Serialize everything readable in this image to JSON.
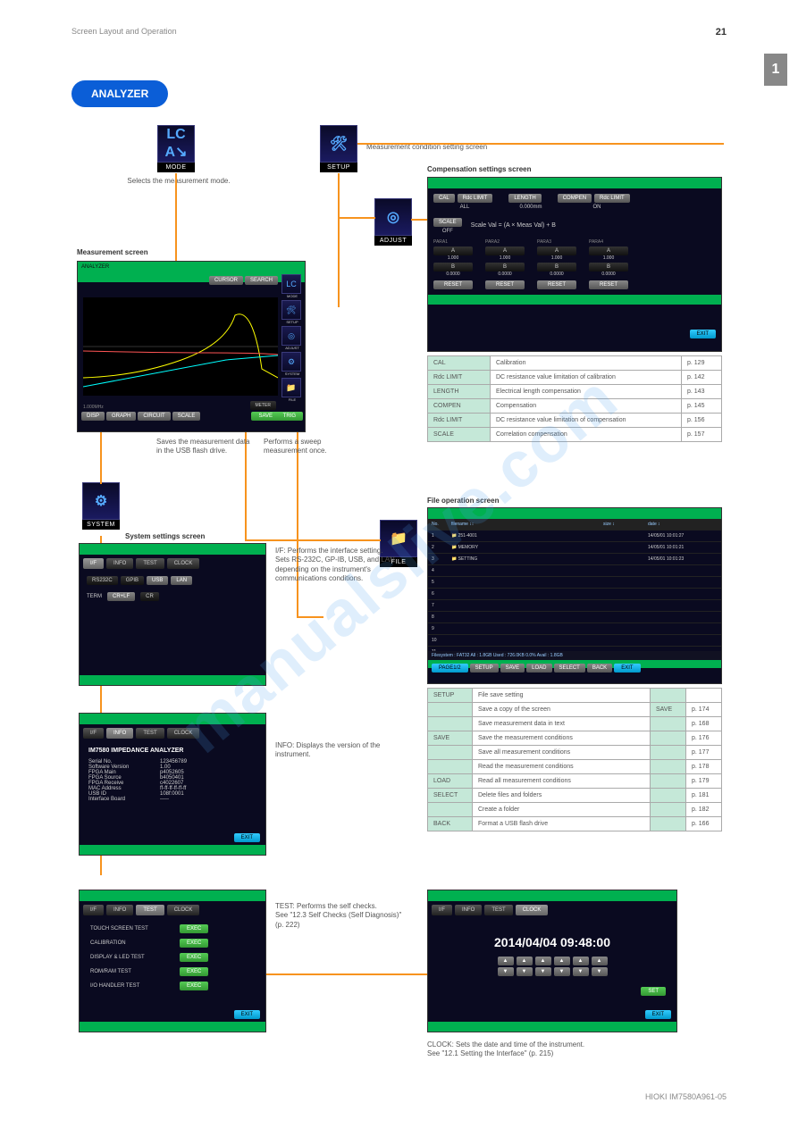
{
  "header": {
    "left": "Screen Layout and Operation",
    "right_page": "21"
  },
  "pill": "ANALYZER",
  "section_title": "Measurement screen",
  "icons": {
    "mode": "MODE",
    "mode_caption": "Selects the measurement mode.",
    "setup": "SETUP",
    "setup_title": "Measurement condition setting screen",
    "adjust": "ADJUST",
    "adjust_title": "Compensation settings screen",
    "system": "SYSTEM",
    "system_title": "System settings screen",
    "file": "FILE",
    "file_title": "File operation screen"
  },
  "analyzer_screen": {
    "title": "ANALYZER",
    "top_buttons": [
      "CURSOR",
      "SEARCH"
    ],
    "bottom_buttons": [
      "DISP",
      "GRAPH",
      "CIRCUIT",
      "SCALE"
    ],
    "save": "SAVE",
    "trig": "TRIG",
    "side": [
      "MODE",
      "SETUP",
      "ADJUST",
      "SYSTEM",
      "FILE"
    ],
    "meter": "METER"
  },
  "adjust_screen": {
    "btns": {
      "cal": "CAL",
      "rdc1": "Rdc LIMIT",
      "length": "LENGTH",
      "compen": "COMPEN",
      "rdc2": "Rdc LIMIT"
    },
    "vals": {
      "all": "ALL",
      "len": "0.000mm",
      "on": "ON"
    },
    "scale_lbl": "SCALE",
    "scale_state": "OFF",
    "scale_formula": "Scale Val = (A × Meas Val) + B",
    "param_labels": [
      "PARA1",
      "PARA2",
      "PARA3",
      "PARA4"
    ],
    "a": "A",
    "aval": "1.000",
    "b": "B",
    "bval": "0.0000",
    "reset": "RESET",
    "exit": "EXIT"
  },
  "adjust_table": {
    "rows": [
      [
        "CAL",
        "Calibration",
        "p. 129"
      ],
      [
        "Rdc LIMIT",
        "DC resistance value limitation of calibration",
        "p. 142"
      ],
      [
        "LENGTH",
        "Electrical length compensation",
        "p. 143"
      ],
      [
        "COMPEN",
        "Compensation",
        "p. 145"
      ],
      [
        "Rdc LIMIT",
        "DC resistance value limitation of compensation",
        "p. 156"
      ],
      [
        "SCALE",
        "Correlation compensation",
        "p. 157"
      ]
    ]
  },
  "file_screen": {
    "headers": [
      "No.",
      "filename ↕↕",
      "size ↕",
      "date ↕"
    ],
    "rows": [
      [
        "1",
        "251-4001",
        "",
        "14/05/01 10:01:27"
      ],
      [
        "2",
        "MEMORY",
        "",
        "14/05/01 10:01:21"
      ],
      [
        "3",
        "SETTING",
        "",
        "14/05/01 10:01:23"
      ]
    ],
    "fsline": "Filesystem : FAT32  All :  1.8GB  Used :  726.0KB  0.0%  Avail :  1.8GB",
    "btns": [
      "PAGE1/2",
      "SETUP",
      "SAVE",
      "LOAD",
      "SELECT",
      "BACK",
      "EXIT"
    ]
  },
  "file_table": {
    "rows": [
      [
        "SETUP",
        "File save setting",
        "",
        ""
      ],
      [
        "",
        "Save a copy of the screen",
        "SAVE",
        "p. 174"
      ],
      [
        "",
        "Save measurement data in text",
        "",
        "p. 168"
      ],
      [
        "SAVE",
        "Save the measurement conditions",
        "",
        "p. 176"
      ],
      [
        "",
        "Save all measurement conditions",
        "",
        "p. 177"
      ],
      [
        "",
        "Read the measurement conditions",
        "",
        "p. 178"
      ],
      [
        "LOAD",
        "Read all measurement conditions",
        "",
        "p. 179"
      ],
      [
        "SELECT",
        "Delete files and folders",
        "",
        "p. 181"
      ],
      [
        "",
        "Create a folder",
        "",
        "p. 182"
      ],
      [
        "BACK",
        "Format a USB flash drive",
        "",
        "p. 166"
      ]
    ]
  },
  "system_if": {
    "tabs": [
      "I/F",
      "INFO",
      "TEST",
      "CLOCK"
    ],
    "row1": [
      "RS232C",
      "GPIB",
      "USB",
      "LAN"
    ],
    "term": "TERM",
    "termopts": [
      "CR+LF",
      "CR"
    ]
  },
  "system_desc": {
    "if": "I/F: Performs the interface setting.\nSets RS-232C, GP-IB, USB, and LAN depending on the instrument's communications conditions.",
    "info": "INFO: Displays the version of the instrument.",
    "test": "TEST: Performs the self checks.\nSee \"12.3 Self Checks (Self Diagnosis)\" (p. 222)",
    "clock": "CLOCK: Sets the date and time of the instrument.\nSee \"12.1 Setting the Interface\" (p. 215)"
  },
  "info_screen": {
    "title": "IM7580 IMPEDANCE ANALYZER",
    "rows": [
      [
        "Serial No.",
        "123456789"
      ],
      [
        "Software Version",
        "1.00"
      ],
      [
        "FPGA Main",
        "p4052605"
      ],
      [
        "FPGA Source",
        "b4050401"
      ],
      [
        "FPGA Receive",
        "c4022607"
      ],
      [
        "MAC Address",
        "ff-ff-ff-ff-ff-ff"
      ],
      [
        "USB ID",
        "108f:0001"
      ],
      [
        "Interface Board",
        "-----"
      ]
    ],
    "exit": "EXIT"
  },
  "test_screen": {
    "rows": [
      [
        "TOUCH SCREEN TEST",
        "EXEC"
      ],
      [
        "CALIBRATION",
        "EXEC"
      ],
      [
        "DISPLAY & LED TEST",
        "EXEC"
      ],
      [
        "ROM/RAM TEST",
        "EXEC"
      ],
      [
        "I/O HANDLER TEST",
        "EXEC"
      ]
    ],
    "exit": "EXIT"
  },
  "clock_screen": {
    "datetime": "2014/04/04  09:48:00",
    "set": "SET",
    "exit": "EXIT"
  },
  "right_desc": {
    "save": "Saves the measurement data in the USB flash drive.",
    "trig": "Performs a sweep measurement once."
  },
  "footer": {
    "right": "HIOKI IM7580A961-05"
  },
  "sidebar_num": "1"
}
